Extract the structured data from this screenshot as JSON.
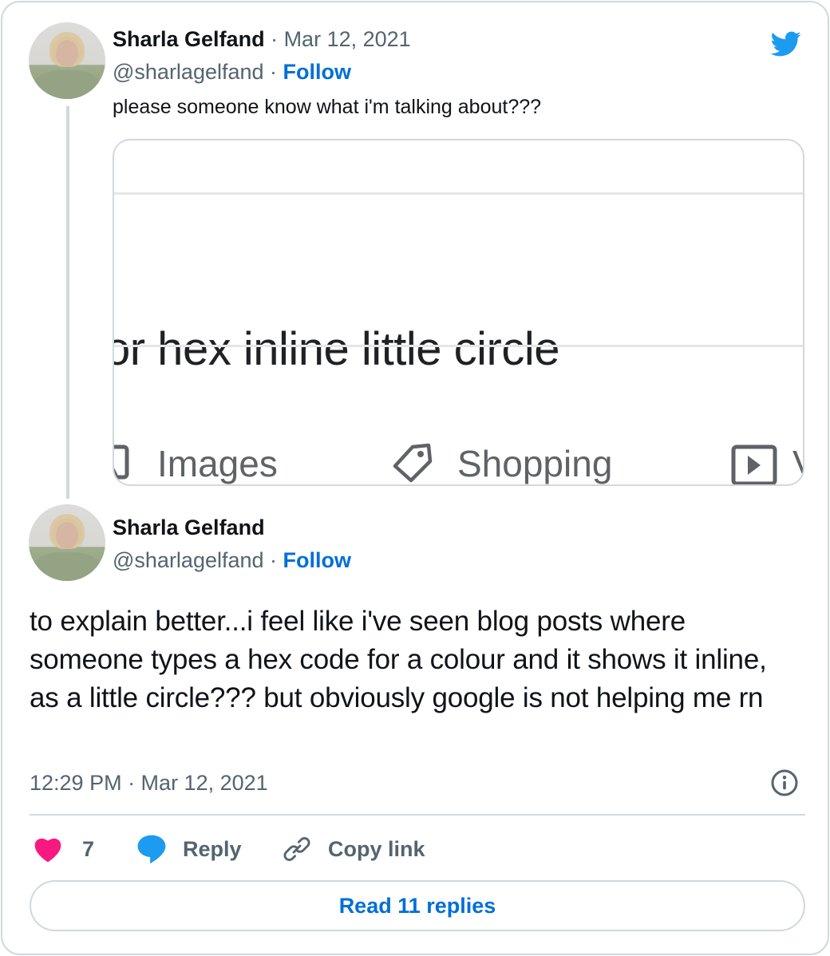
{
  "colors": {
    "follow_link": "#006fd6",
    "twitter_blue": "#1d9bf0",
    "like_pink": "#f91880",
    "muted_text": "#536471",
    "border": "#cfd9de"
  },
  "parent_tweet": {
    "author_name": "Sharla Gelfand",
    "separator": " · ",
    "date": "Mar 12, 2021",
    "handle": "@sharlagelfand",
    "follow_label": "Follow",
    "text": "please someone know what i'm talking about???",
    "avatar_icon": "profile-photo",
    "media": {
      "search_query_fragment": "or hex inline little circle",
      "tabs": [
        {
          "icon": "image-icon",
          "label": "Images"
        },
        {
          "icon": "tag-icon",
          "label": "Shopping"
        },
        {
          "icon": "video-play-icon",
          "label": "V"
        }
      ]
    }
  },
  "main_tweet": {
    "author_name": "Sharla Gelfand",
    "handle": "@sharlagelfand",
    "separator": " · ",
    "follow_label": "Follow",
    "text": "to explain better...i feel like i've seen blog posts where someone types a hex code for a colour and it shows it inline, as a little circle??? but obviously google is not helping me rn",
    "timestamp": "12:29 PM · Mar 12, 2021",
    "info_icon": "info-icon",
    "actions": {
      "like_count": "7",
      "reply_label": "Reply",
      "copy_link_label": "Copy link"
    },
    "read_replies_label": "Read 11 replies"
  },
  "brand_icon": "twitter-bird-icon"
}
